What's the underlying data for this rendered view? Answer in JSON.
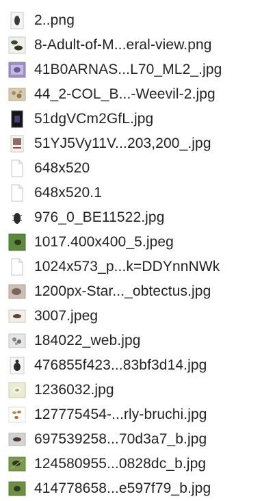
{
  "files": [
    {
      "name": "2..png",
      "icon": "image-thumb-icon"
    },
    {
      "name": "8-Adult-of-M...eral-view.png",
      "icon": "image-thumb-icon"
    },
    {
      "name": "41B0ARNAS...L70_ML2_.jpg",
      "icon": "image-thumb-icon"
    },
    {
      "name": "44_2-COL_B...-Weevil-2.jpg",
      "icon": "image-thumb-icon"
    },
    {
      "name": "51dgVCm2GfL.jpg",
      "icon": "image-thumb-icon"
    },
    {
      "name": "51YJ5Vy11V...203,200_.jpg",
      "icon": "image-thumb-icon"
    },
    {
      "name": "648x520",
      "icon": "blank-document-icon"
    },
    {
      "name": "648x520.1",
      "icon": "blank-document-icon"
    },
    {
      "name": "976_0_BE11522.jpg",
      "icon": "image-thumb-icon"
    },
    {
      "name": "1017.400x400_5.jpeg",
      "icon": "image-thumb-icon"
    },
    {
      "name": "1024x573_p...k=DDYnnNWk",
      "icon": "blank-document-icon"
    },
    {
      "name": "1200px-Star..._obtectus.jpg",
      "icon": "image-thumb-icon"
    },
    {
      "name": "3007.jpeg",
      "icon": "image-thumb-icon"
    },
    {
      "name": "184022_web.jpg",
      "icon": "image-thumb-icon"
    },
    {
      "name": "476855f423...83bf3d14.jpg",
      "icon": "image-thumb-icon"
    },
    {
      "name": "1236032.jpg",
      "icon": "image-thumb-icon"
    },
    {
      "name": "127775454-...rly-bruchi.jpg",
      "icon": "image-thumb-icon"
    },
    {
      "name": "697539258...70d3a7_b.jpg",
      "icon": "image-thumb-icon"
    },
    {
      "name": "124580955...0828dc_b.jpg",
      "icon": "image-thumb-icon"
    },
    {
      "name": "414778658...e597f79_b.jpg",
      "icon": "image-thumb-icon"
    }
  ]
}
